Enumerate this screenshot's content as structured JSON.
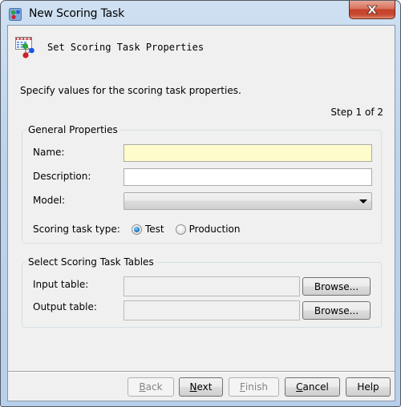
{
  "window": {
    "title": "New Scoring Task",
    "app_icon": "scoring-task-icon",
    "close_icon": "close-icon"
  },
  "header": {
    "icon": "scoring-table-model-icon",
    "title": "Set Scoring Task Properties"
  },
  "instructions": "Specify values for the scoring task properties.",
  "step": "Step 1 of 2",
  "general_properties": {
    "legend": "General Properties",
    "name": {
      "label": "Name:",
      "value": "",
      "required": true
    },
    "description": {
      "label": "Description:",
      "value": ""
    },
    "model": {
      "label": "Model:",
      "selected": ""
    },
    "scoring_task_type": {
      "label": "Scoring task type:",
      "options": [
        {
          "label": "Test",
          "checked": true
        },
        {
          "label": "Production",
          "checked": false
        }
      ]
    }
  },
  "tables": {
    "legend": "Select Scoring Task Tables",
    "input_table": {
      "label": "Input table:",
      "value": "",
      "browse_label": "Browse..."
    },
    "output_table": {
      "label": "Output table:",
      "value": "",
      "browse_label": "Browse..."
    }
  },
  "buttons": {
    "back": {
      "mnemonic": "B",
      "rest": "ack",
      "enabled": false
    },
    "next": {
      "mnemonic": "N",
      "rest": "ext",
      "enabled": true
    },
    "finish": {
      "mnemonic": "F",
      "rest": "inish",
      "enabled": false
    },
    "cancel": {
      "mnemonic": "C",
      "rest": "ancel",
      "enabled": true
    },
    "help": {
      "label": "Help",
      "enabled": true
    }
  }
}
